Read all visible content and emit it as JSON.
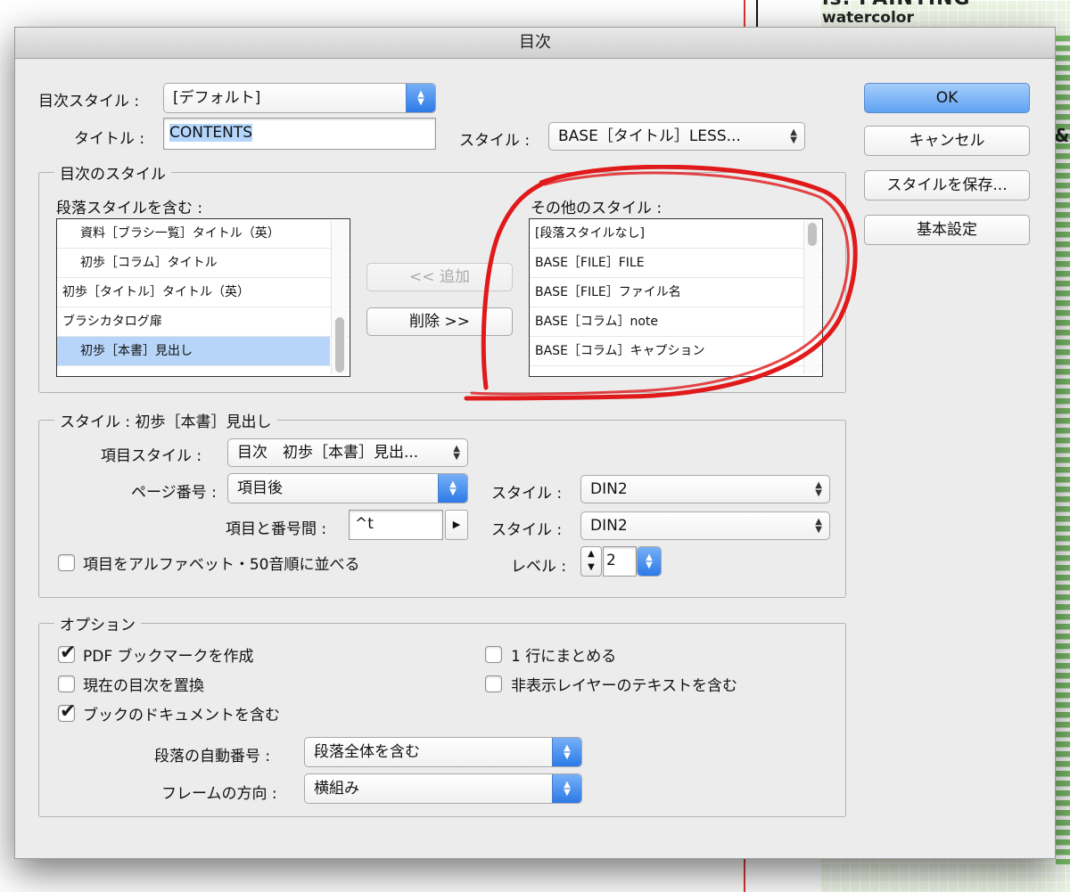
{
  "background": {
    "heading_fragment": "ls: PAINTING",
    "subtext": "watercolor",
    "side_fragment": "&A"
  },
  "dialog": {
    "title": "目次",
    "toc_style": {
      "label": "目次スタイル :",
      "value": "[デフォルト]"
    },
    "title_row": {
      "label": "タイトル :",
      "value": "CONTENTS",
      "style_label": "スタイル :",
      "style_value": "BASE［タイトル］LESS..."
    },
    "buttons": {
      "ok": "OK",
      "cancel": "キャンセル",
      "save_style": "スタイルを保存...",
      "basic_settings": "基本設定"
    },
    "toc_styles_group": {
      "title": "目次のスタイル",
      "included_label": "段落スタイルを含む :",
      "included_items": [
        "資料［ブラシ一覧］タイトル（英）",
        "初歩［コラム］タイトル",
        "初歩［タイトル］タイトル（英）",
        "ブラシカタログ扉",
        "初歩［本書］見出し"
      ],
      "add_button": "<< 追加",
      "remove_button": "削除 >>",
      "other_label": "その他のスタイル :",
      "other_items": [
        "[段落スタイルなし]",
        "BASE［FILE］FILE",
        "BASE［FILE］ファイル名",
        "BASE［コラム］note",
        "BASE［コラム］キャプション"
      ]
    },
    "style_group": {
      "title": "スタイル : 初歩［本書］見出し",
      "entry_style_label": "項目スタイル :",
      "entry_style_value": "目次　初歩［本書］見出...",
      "page_number_label": "ページ番号 :",
      "page_number_value": "項目後",
      "page_style_label": "スタイル :",
      "page_style_value": "DIN2",
      "between_label": "項目と番号間 :",
      "between_value": "^t",
      "between_style_label": "スタイル :",
      "between_style_value": "DIN2",
      "sort_label": "項目をアルファベット・50音順に並べる",
      "sort_checked": false,
      "level_label": "レベル :",
      "level_value": "2"
    },
    "options_group": {
      "title": "オプション",
      "pdf_bookmark": {
        "label": "PDF ブックマークを作成",
        "checked": true
      },
      "replace_toc": {
        "label": "現在の目次を置換",
        "checked": false
      },
      "include_book": {
        "label": "ブックのドキュメントを含む",
        "checked": true
      },
      "run_in": {
        "label": "1 行にまとめる",
        "checked": false
      },
      "hidden_layers": {
        "label": "非表示レイヤーのテキストを含む",
        "checked": false
      },
      "numbered_label": "段落の自動番号 :",
      "numbered_value": "段落全体を含む",
      "frame_dir_label": "フレームの方向 :",
      "frame_dir_value": "横組み"
    }
  },
  "colors": {
    "annotation": "#e0191b",
    "default_button": "#5fa2f3",
    "selection": "#b7d5f8"
  }
}
